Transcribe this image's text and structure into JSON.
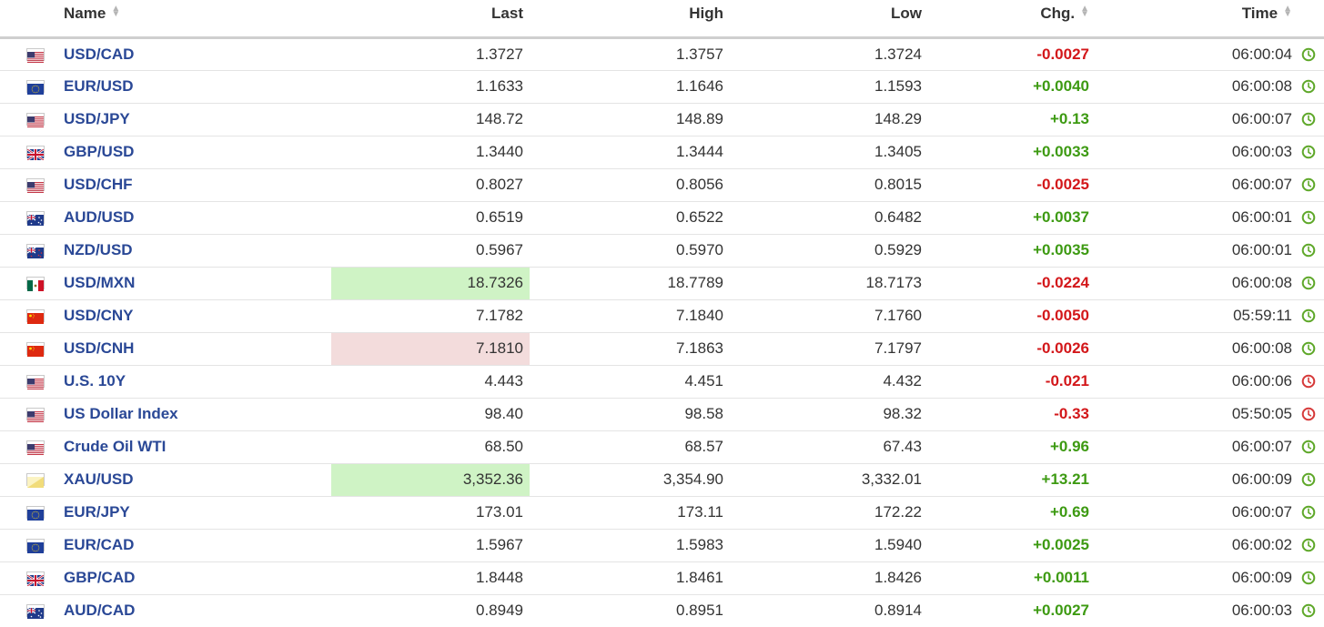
{
  "header": {
    "name": "Name",
    "last": "Last",
    "high": "High",
    "low": "Low",
    "chg": "Chg.",
    "time": "Time"
  },
  "colors": {
    "positive": "#3d9a12",
    "negative": "#d3171a",
    "link": "#2a4896",
    "highlight_up": "#cff3c5",
    "highlight_down": "#f3dcdc",
    "clock_open": "#5fa82a",
    "clock_closed": "#d63a3a"
  },
  "rows": [
    {
      "flag": "us-flag-icon",
      "name": "USD/CAD",
      "last": "1.3727",
      "high": "1.3757",
      "low": "1.3724",
      "chg": "-0.0027",
      "dir": "neg",
      "time": "06:00:04",
      "clock": "green-clock-icon",
      "highlight": ""
    },
    {
      "flag": "eu-flag-icon",
      "name": "EUR/USD",
      "last": "1.1633",
      "high": "1.1646",
      "low": "1.1593",
      "chg": "+0.0040",
      "dir": "pos",
      "time": "06:00:08",
      "clock": "green-clock-icon",
      "highlight": ""
    },
    {
      "flag": "us-flag-icon",
      "name": "USD/JPY",
      "last": "148.72",
      "high": "148.89",
      "low": "148.29",
      "chg": "+0.13",
      "dir": "pos",
      "time": "06:00:07",
      "clock": "green-clock-icon",
      "highlight": ""
    },
    {
      "flag": "uk-flag-icon",
      "name": "GBP/USD",
      "last": "1.3440",
      "high": "1.3444",
      "low": "1.3405",
      "chg": "+0.0033",
      "dir": "pos",
      "time": "06:00:03",
      "clock": "green-clock-icon",
      "highlight": ""
    },
    {
      "flag": "us-flag-icon",
      "name": "USD/CHF",
      "last": "0.8027",
      "high": "0.8056",
      "low": "0.8015",
      "chg": "-0.0025",
      "dir": "neg",
      "time": "06:00:07",
      "clock": "green-clock-icon",
      "highlight": ""
    },
    {
      "flag": "au-flag-icon",
      "name": "AUD/USD",
      "last": "0.6519",
      "high": "0.6522",
      "low": "0.6482",
      "chg": "+0.0037",
      "dir": "pos",
      "time": "06:00:01",
      "clock": "green-clock-icon",
      "highlight": ""
    },
    {
      "flag": "nz-flag-icon",
      "name": "NZD/USD",
      "last": "0.5967",
      "high": "0.5970",
      "low": "0.5929",
      "chg": "+0.0035",
      "dir": "pos",
      "time": "06:00:01",
      "clock": "green-clock-icon",
      "highlight": ""
    },
    {
      "flag": "mx-flag-icon",
      "name": "USD/MXN",
      "last": "18.7326",
      "high": "18.7789",
      "low": "18.7173",
      "chg": "-0.0224",
      "dir": "neg",
      "time": "06:00:08",
      "clock": "green-clock-icon",
      "highlight": "up"
    },
    {
      "flag": "cn-flag-icon",
      "name": "USD/CNY",
      "last": "7.1782",
      "high": "7.1840",
      "low": "7.1760",
      "chg": "-0.0050",
      "dir": "neg",
      "time": "05:59:11",
      "clock": "green-clock-icon",
      "highlight": ""
    },
    {
      "flag": "cn-flag-icon",
      "name": "USD/CNH",
      "last": "7.1810",
      "high": "7.1863",
      "low": "7.1797",
      "chg": "-0.0026",
      "dir": "neg",
      "time": "06:00:08",
      "clock": "green-clock-icon",
      "highlight": "down"
    },
    {
      "flag": "us-flag-icon",
      "name": "U.S. 10Y",
      "last": "4.443",
      "high": "4.451",
      "low": "4.432",
      "chg": "-0.021",
      "dir": "neg",
      "time": "06:00:06",
      "clock": "red-clock-icon",
      "highlight": ""
    },
    {
      "flag": "us-flag-icon",
      "name": "US Dollar Index",
      "last": "98.40",
      "high": "98.58",
      "low": "98.32",
      "chg": "-0.33",
      "dir": "neg",
      "time": "05:50:05",
      "clock": "red-clock-icon",
      "highlight": ""
    },
    {
      "flag": "us-flag-icon",
      "name": "Crude Oil WTI",
      "last": "68.50",
      "high": "68.57",
      "low": "67.43",
      "chg": "+0.96",
      "dir": "pos",
      "time": "06:00:07",
      "clock": "green-clock-icon",
      "highlight": ""
    },
    {
      "flag": "gold-icon",
      "name": "XAU/USD",
      "last": "3,352.36",
      "high": "3,354.90",
      "low": "3,332.01",
      "chg": "+13.21",
      "dir": "pos",
      "time": "06:00:09",
      "clock": "green-clock-icon",
      "highlight": "up"
    },
    {
      "flag": "eu-flag-icon",
      "name": "EUR/JPY",
      "last": "173.01",
      "high": "173.11",
      "low": "172.22",
      "chg": "+0.69",
      "dir": "pos",
      "time": "06:00:07",
      "clock": "green-clock-icon",
      "highlight": ""
    },
    {
      "flag": "eu-flag-icon",
      "name": "EUR/CAD",
      "last": "1.5967",
      "high": "1.5983",
      "low": "1.5940",
      "chg": "+0.0025",
      "dir": "pos",
      "time": "06:00:02",
      "clock": "green-clock-icon",
      "highlight": ""
    },
    {
      "flag": "uk-flag-icon",
      "name": "GBP/CAD",
      "last": "1.8448",
      "high": "1.8461",
      "low": "1.8426",
      "chg": "+0.0011",
      "dir": "pos",
      "time": "06:00:09",
      "clock": "green-clock-icon",
      "highlight": ""
    },
    {
      "flag": "au-flag-icon",
      "name": "AUD/CAD",
      "last": "0.8949",
      "high": "0.8951",
      "low": "0.8914",
      "chg": "+0.0027",
      "dir": "pos",
      "time": "06:00:03",
      "clock": "green-clock-icon",
      "highlight": ""
    }
  ]
}
